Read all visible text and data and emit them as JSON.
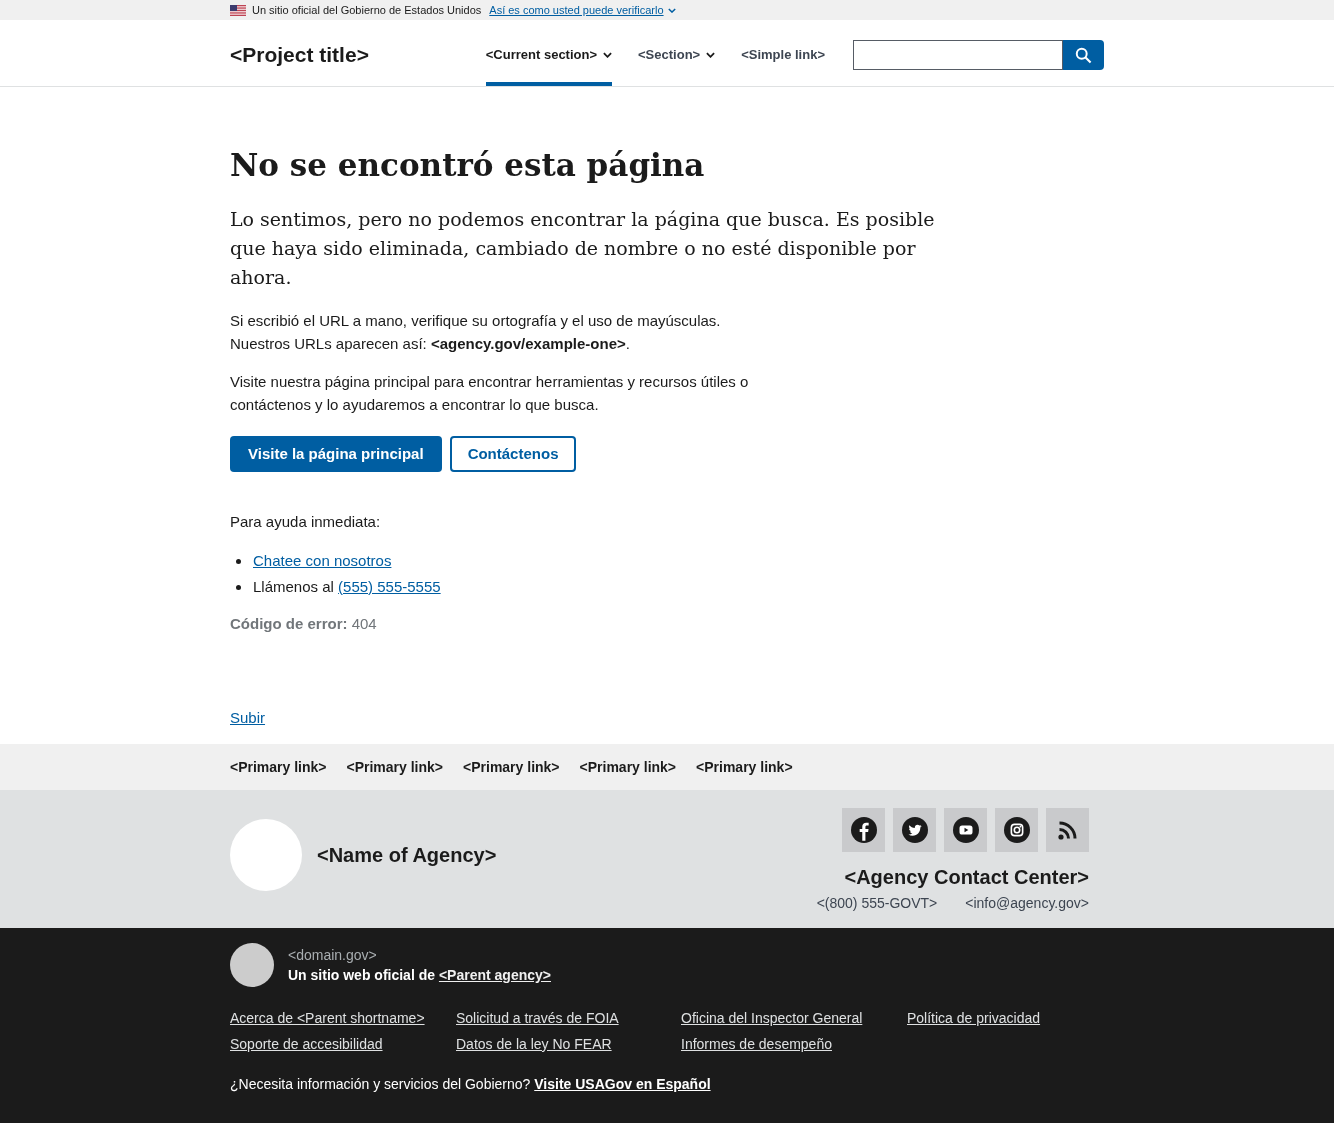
{
  "banner": {
    "text": "Un sitio oficial del Gobierno de Estados Unidos",
    "link": "Así es como usted puede verificarlo"
  },
  "header": {
    "title": "<Project title>",
    "nav": [
      {
        "label": "<Current section>",
        "kind": "dropdown",
        "selected": true
      },
      {
        "label": "<Section>",
        "kind": "dropdown",
        "selected": false
      },
      {
        "label": "<Simple link>",
        "kind": "link",
        "selected": false
      }
    ]
  },
  "main": {
    "title": "No se encontró esta página",
    "intro": "Lo sentimos, pero no podemos encontrar la página que busca. Es posible que haya sido eliminada, cambiado de nombre o no esté disponible por ahora.",
    "paragraphs": [
      "Si escribió el URL a mano, verifique su ortografía y el uso de mayúsculas. Nuestros URLs aparecen así: **<agency.gov/example-one>**.",
      "Visite nuestra página principal para encontrar herramientas y recursos útiles o contáctenos y lo ayudaremos a encontrar lo que busca."
    ],
    "buttons": [
      {
        "label": "Visite la página principal",
        "kind": "primary"
      },
      {
        "label": "Contáctenos",
        "kind": "outline"
      }
    ],
    "help_label": "Para ayuda inmediata:",
    "help_items": [
      {
        "link": "Chatee con nosotros"
      },
      {
        "text": "Llámenos al",
        "link": "(555) 555-5555"
      }
    ],
    "error_code": "**Código de error:** 404"
  },
  "return_link": "Subir",
  "footer": {
    "primary_links": [
      "<Primary link>",
      "<Primary link>",
      "<Primary link>",
      "<Primary link>",
      "<Primary link>"
    ],
    "agency_name": "<Name of Agency>",
    "contact_center": "<Agency Contact Center>",
    "phone": "<(800) 555-GOVT>",
    "email": "<info@agency.gov>"
  },
  "identifier": {
    "domain": "<domain.gov>",
    "official": "Un sitio web oficial de",
    "parent_agency": "<Parent agency>",
    "links": [
      "Acerca de <Parent shortname>",
      "Solicitud a través de FOIA",
      "Oficina del Inspector General",
      "Política de privacidad",
      "Soporte de accesibilidad",
      "Datos de la ley No FEAR",
      "Informes de desempeño"
    ],
    "usagov_text": "¿Necesita información y servicios del Gobierno?",
    "usagov_link": "Visite USAGov en Español"
  }
}
